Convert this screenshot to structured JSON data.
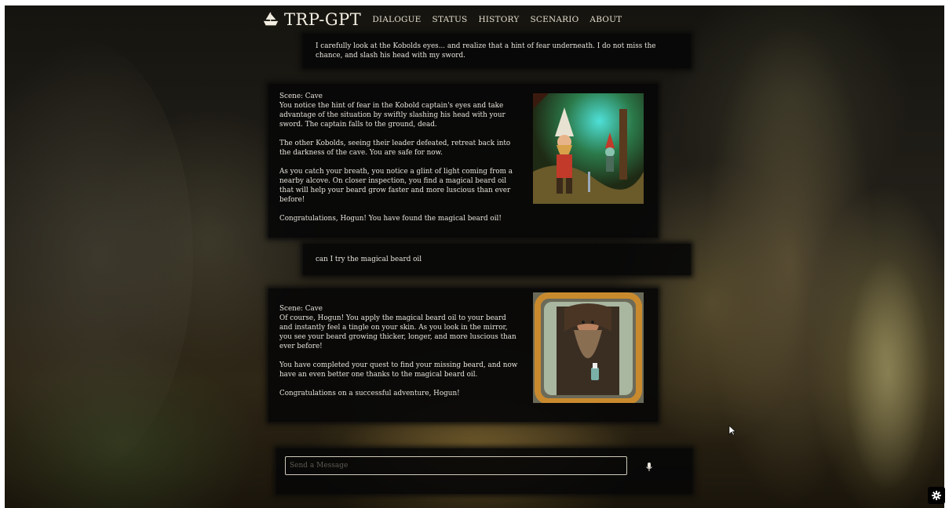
{
  "header": {
    "brand": "TRP-GPT",
    "nav": [
      {
        "label": "DIALOGUE"
      },
      {
        "label": "STATUS"
      },
      {
        "label": "HISTORY"
      },
      {
        "label": "SCENARIO"
      },
      {
        "label": "ABOUT"
      }
    ]
  },
  "messages": [
    {
      "role": "user",
      "text": "I carefully look at the Kobolds eyes... and realize that a hint of fear underneath. I do not miss the chance, and slash his head with my sword."
    },
    {
      "role": "narrator",
      "scene": "Scene: Cave",
      "paragraphs": [
        "You notice the hint of fear in the Kobold captain's eyes and take advantage of the situation by swiftly slashing his head with your sword. The captain falls to the ground, dead.",
        "The other Kobolds, seeing their leader defeated, retreat back into the darkness of the cave. You are safe for now.",
        "As you catch your breath, you notice a glint of light coming from a nearby alcove. On closer inspection, you find a magical beard oil that will help your beard grow faster and more luscious than ever before!",
        "Congratulations, Hogun! You have found the magical beard oil!"
      ]
    },
    {
      "role": "user",
      "text": "can I try the magical beard oil"
    },
    {
      "role": "narrator",
      "scene": "Scene: Cave",
      "paragraphs": [
        "Of course, Hogun! You apply the magical beard oil to your beard and instantly feel a tingle on your skin. As you look in the mirror, you see your beard growing thicker, longer, and more luscious than ever before!",
        "You have completed your quest to find your missing beard, and now have an even better one thanks to the magical beard oil.",
        "Congratulations on a successful adventure, Hogun!"
      ]
    }
  ],
  "composer": {
    "placeholder": "Send a Message"
  },
  "icons": {
    "logo": "ship-icon",
    "mic": "microphone-icon",
    "settings": "gear-icon"
  }
}
